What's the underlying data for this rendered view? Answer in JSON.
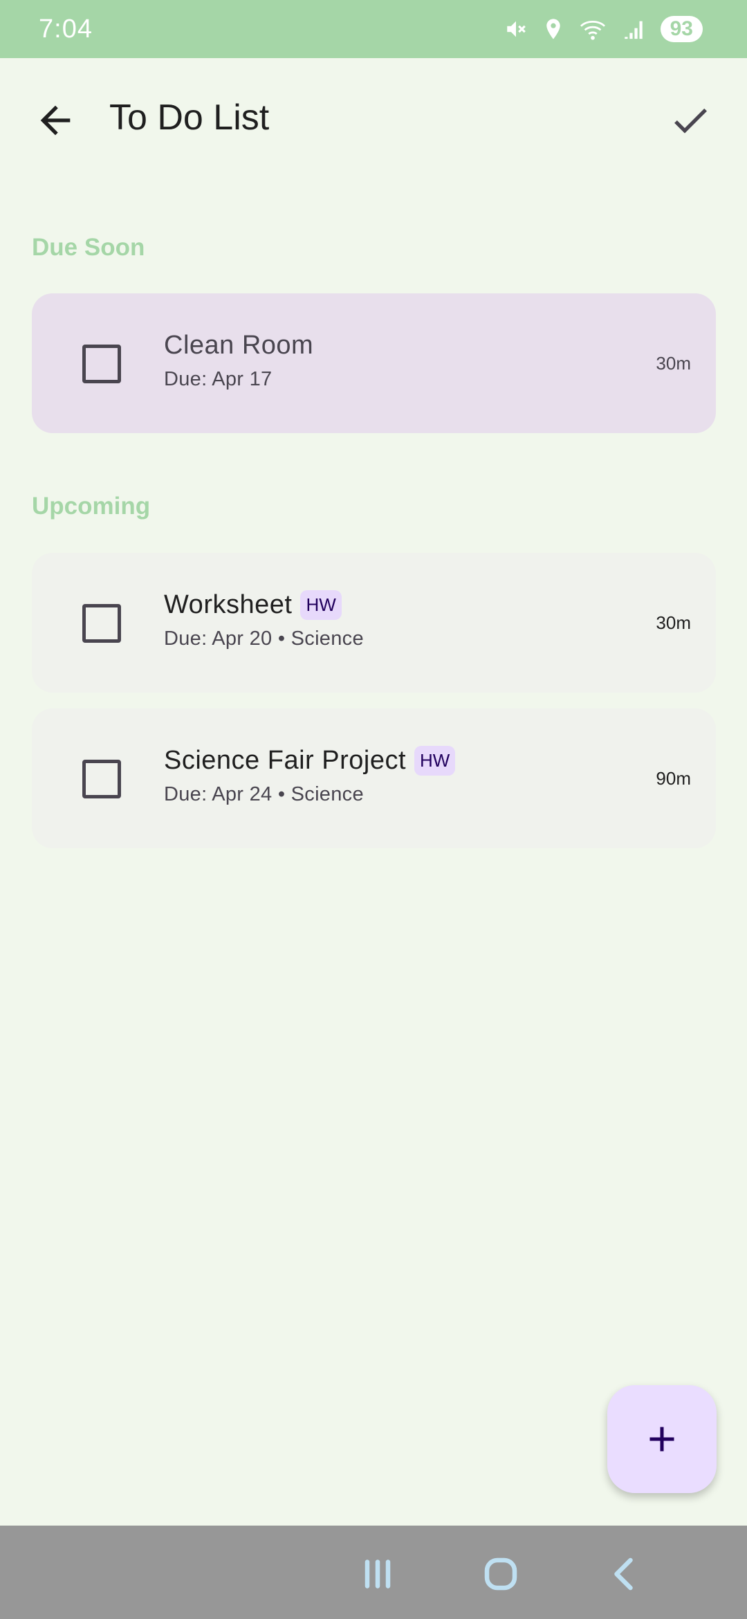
{
  "status_bar": {
    "time": "7:04",
    "battery": "93",
    "icons": [
      "mute-icon",
      "location-icon",
      "wifi-icon",
      "signal-icon",
      "battery-icon"
    ]
  },
  "app_bar": {
    "title": "To Do List",
    "back_icon": "arrow-back-icon",
    "confirm_icon": "check-icon"
  },
  "sections": [
    {
      "header": "Due Soon",
      "tasks": [
        {
          "title": "Clean Room",
          "subtitle": "Due: Apr 17",
          "duration": "30m",
          "tag": ""
        }
      ]
    },
    {
      "header": "Upcoming",
      "tasks": [
        {
          "title": "Worksheet",
          "subtitle": "Due: Apr 20 • Science",
          "duration": "30m",
          "tag": "HW"
        },
        {
          "title": "Science Fair Project",
          "subtitle": "Due: Apr 24 • Science",
          "duration": "90m",
          "tag": "HW"
        }
      ]
    }
  ],
  "fab": {
    "icon": "plus-icon"
  },
  "nav_bar": {
    "icons": [
      "recents-icon",
      "home-icon",
      "back-icon"
    ]
  },
  "colors": {
    "status_bar": "#A5D6A7",
    "background": "#F1F7EC",
    "section_header": "#A5D6A7",
    "due_soon_card": "#E8DFEC",
    "upcoming_card": "#F0F2ED",
    "tag_bg": "#E7D9FB",
    "fab_bg": "#EADDFF",
    "nav_bar": "#979797"
  }
}
